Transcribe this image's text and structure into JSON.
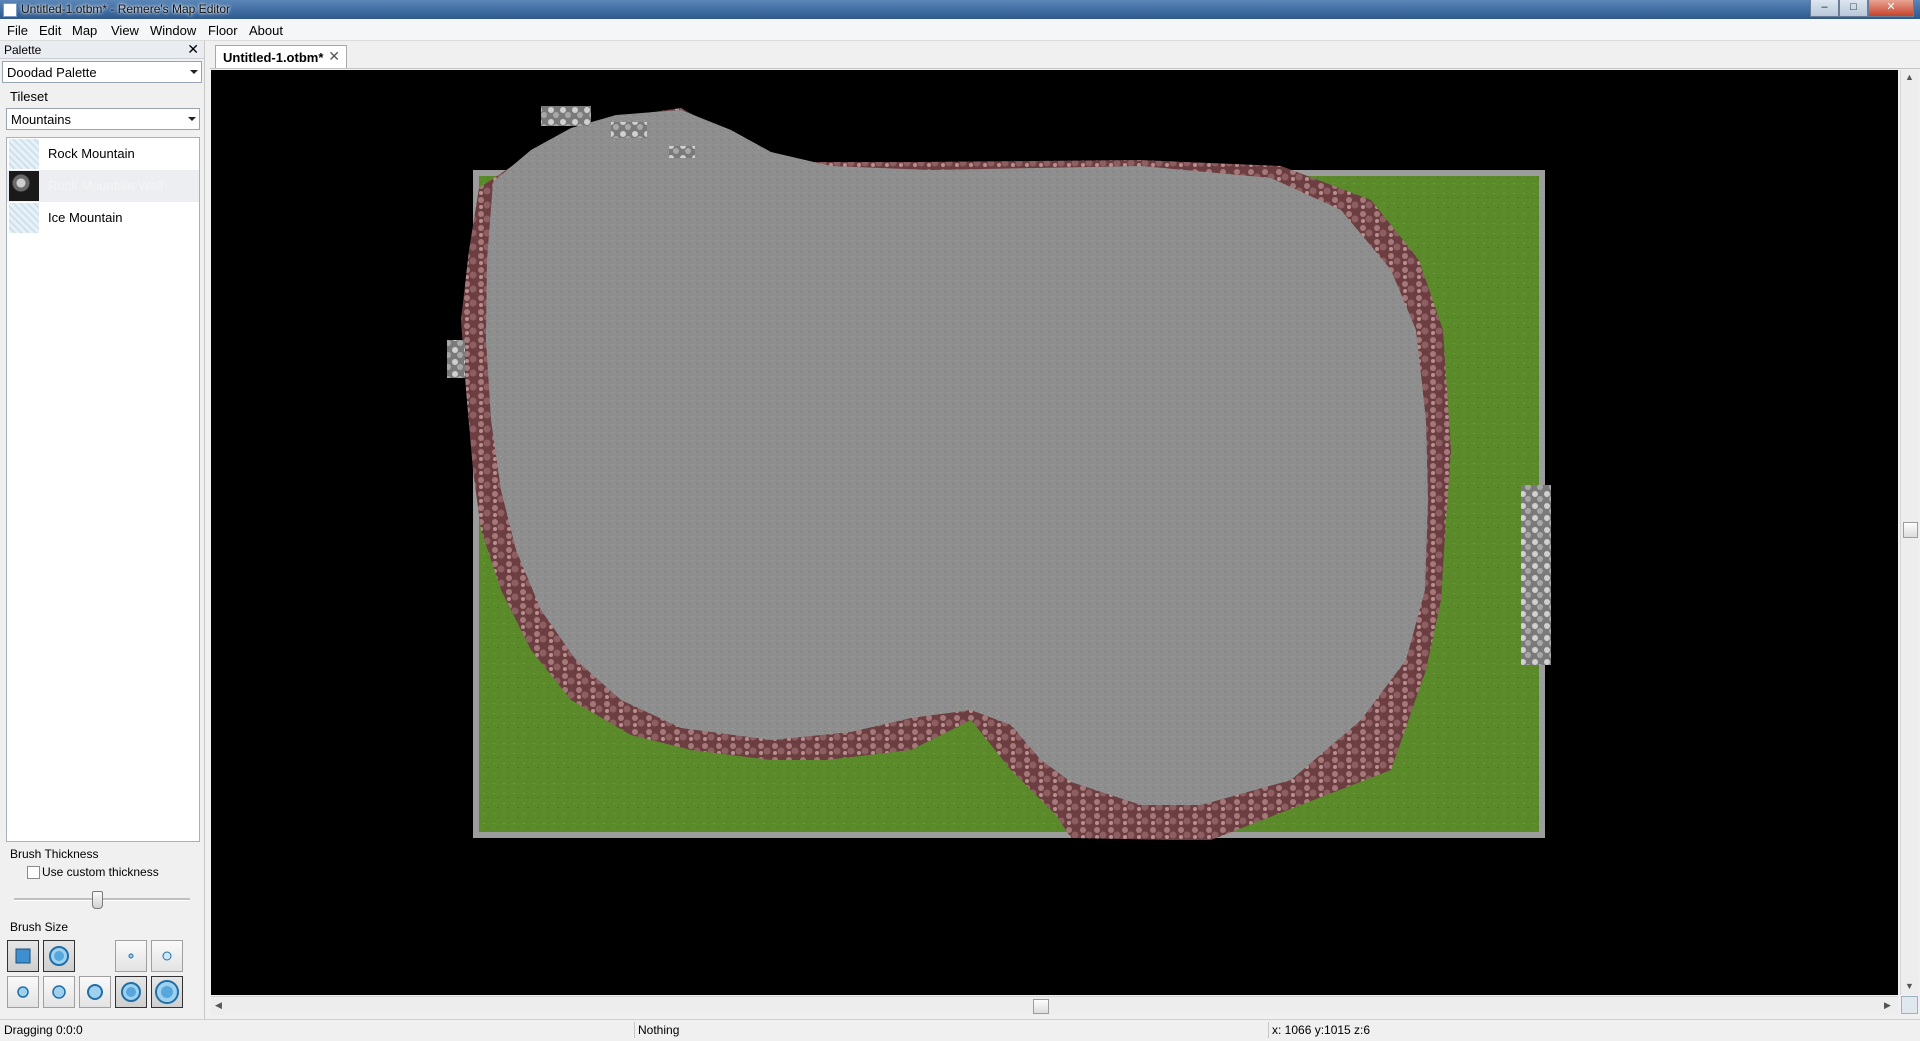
{
  "window": {
    "title": "Untitled-1.otbm* - Remere's Map Editor",
    "minimize_label": "–",
    "maximize_label": "□",
    "close_label": "✕"
  },
  "menu": [
    "File",
    "Edit",
    "Map",
    "View",
    "Window",
    "Floor",
    "About"
  ],
  "palette": {
    "caption": "Palette",
    "close_label": "✕",
    "palette_type": "Doodad Palette",
    "tileset_label": "Tileset",
    "tileset_value": "Mountains",
    "items": [
      "Rock Mountain",
      "Rock Mountain Wall",
      "Ice Mountain"
    ],
    "selected_item": "Rock Mountain Wall",
    "brush_thickness_label": "Brush Thickness",
    "custom_thickness_label": "Use custom thickness",
    "custom_thickness_checked": false,
    "thickness_level": 0.47,
    "brush_size_label": "Brush Size"
  },
  "tabs": [
    {
      "label": "Untitled-1.otbm*",
      "close_label": "✕",
      "active": true
    }
  ],
  "status": {
    "left": "Dragging 0:0:0",
    "middle": "Nothing",
    "right": "x: 1066 y:1015 z:6"
  },
  "colors": {
    "canvas_bg": "#000000",
    "grass": "#5d8a2c",
    "stone": "#8f8f8f",
    "rock": "#7a4a4d",
    "border": "#a6a6a6"
  },
  "icons": {
    "scroll_up": "▲",
    "scroll_down": "▼",
    "scroll_left": "◀",
    "scroll_right": "▶"
  }
}
